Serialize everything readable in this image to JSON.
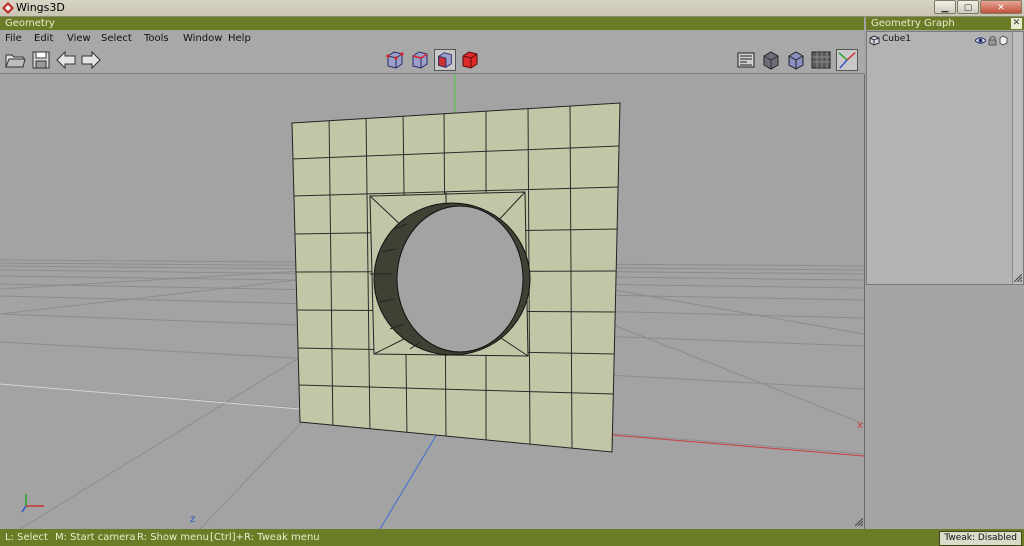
{
  "window": {
    "title": "Wings3D"
  },
  "geometry_panel": {
    "title": "Geometry"
  },
  "graph_panel": {
    "title": "Geometry Graph",
    "items": [
      {
        "label": "Cube1"
      }
    ]
  },
  "menu": {
    "items": [
      "File",
      "Edit",
      "View",
      "Select",
      "Tools",
      "Window",
      "Help"
    ]
  },
  "viewport": {
    "axis_labels": {
      "x": "x",
      "z": "z"
    }
  },
  "statusbar": {
    "hints": [
      "L: Select",
      "M: Start camera",
      "R: Show menu",
      "[Ctrl]+R: Tweak menu"
    ],
    "tweak": "Tweak: Disabled"
  },
  "colors": {
    "panel_bar": "#6b7c26",
    "mesh_face": "#c3c6a6",
    "x_axis": "#c8423c",
    "y_axis": "#4ccb3c",
    "z_axis": "#3a6fd6"
  }
}
